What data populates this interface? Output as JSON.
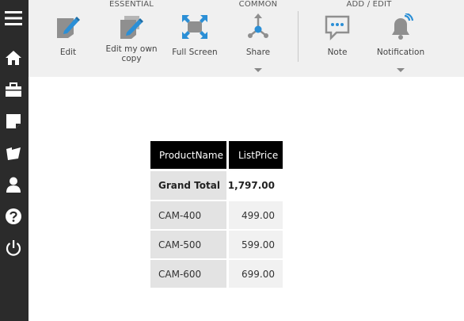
{
  "toolbar": {
    "groups": {
      "essential": "ESSENTIAL",
      "common": "COMMON",
      "add_edit": "ADD / EDIT"
    },
    "items": {
      "edit": "Edit",
      "edit_copy_line1": "Edit my own",
      "edit_copy_line2": "copy",
      "full_screen": "Full Screen",
      "share": "Share",
      "note": "Note",
      "notification": "Notification"
    }
  },
  "sidebar": {
    "icons": [
      "menu-icon",
      "home-icon",
      "briefcase-icon",
      "note-icon",
      "folder-icon",
      "user-icon",
      "help-icon",
      "power-icon"
    ]
  },
  "table": {
    "headers": {
      "name": "ProductName",
      "price": "ListPrice"
    },
    "total": {
      "label": "Grand Total",
      "value": "1,797.00"
    },
    "rows": [
      {
        "name": "CAM-400",
        "price": "499.00"
      },
      {
        "name": "CAM-500",
        "price": "599.00"
      },
      {
        "name": "CAM-600",
        "price": "699.00"
      }
    ]
  },
  "colors": {
    "sidebar_bg": "#2b2b2b",
    "toolbar_bg": "#f0f0f0",
    "accent_blue": "#2b8fd6",
    "icon_gray": "#8f8f8f",
    "header_bg": "#000000"
  }
}
